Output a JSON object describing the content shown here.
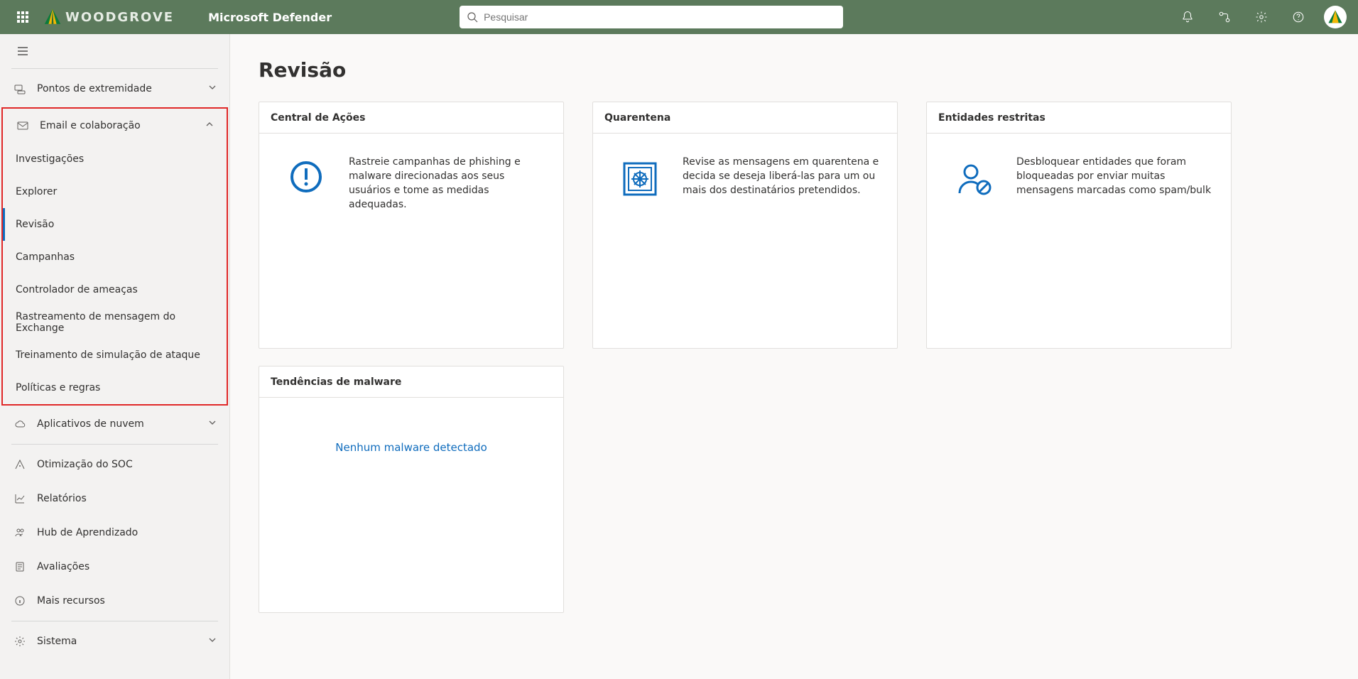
{
  "brand_text": "WOODGROVE",
  "app_title": "Microsoft Defender",
  "search_placeholder": "Pesquisar",
  "sidebar": {
    "endpoints": "Pontos de extremidade",
    "email_collab": "Email e colaboração",
    "sub": {
      "investigacoes": "Investigações",
      "explorer": "Explorer",
      "revisao": "Revisão",
      "campanhas": "Campanhas",
      "controlador": "Controlador de ameaças",
      "rastreamento": "Rastreamento de mensagem do Exchange",
      "treinamento": "Treinamento de simulação de ataque",
      "politicas": "Políticas e regras"
    },
    "cloud_apps": "Aplicativos de nuvem",
    "soc": "Otimização do SOC",
    "relatorios": "Relatórios",
    "hub": "Hub de Aprendizado",
    "avaliacoes": "Avaliações",
    "mais": "Mais recursos",
    "sistema": "Sistema"
  },
  "page": {
    "title": "Revisão",
    "cards": {
      "action_center": {
        "title": "Central de Ações",
        "body": "Rastreie campanhas de phishing e malware direcionadas aos seus usuários e tome as medidas adequadas."
      },
      "quarantine": {
        "title": "Quarentena",
        "body": "Revise as mensagens em quarentena e decida se deseja liberá-las para um ou mais dos destinatários pretendidos."
      },
      "restricted": {
        "title": "Entidades restritas",
        "body": "Desbloquear entidades que foram bloqueadas por enviar muitas mensagens marcadas como spam/bulk"
      },
      "malware_trends": {
        "title": "Tendências de malware",
        "body": "Nenhum malware detectado"
      }
    }
  }
}
